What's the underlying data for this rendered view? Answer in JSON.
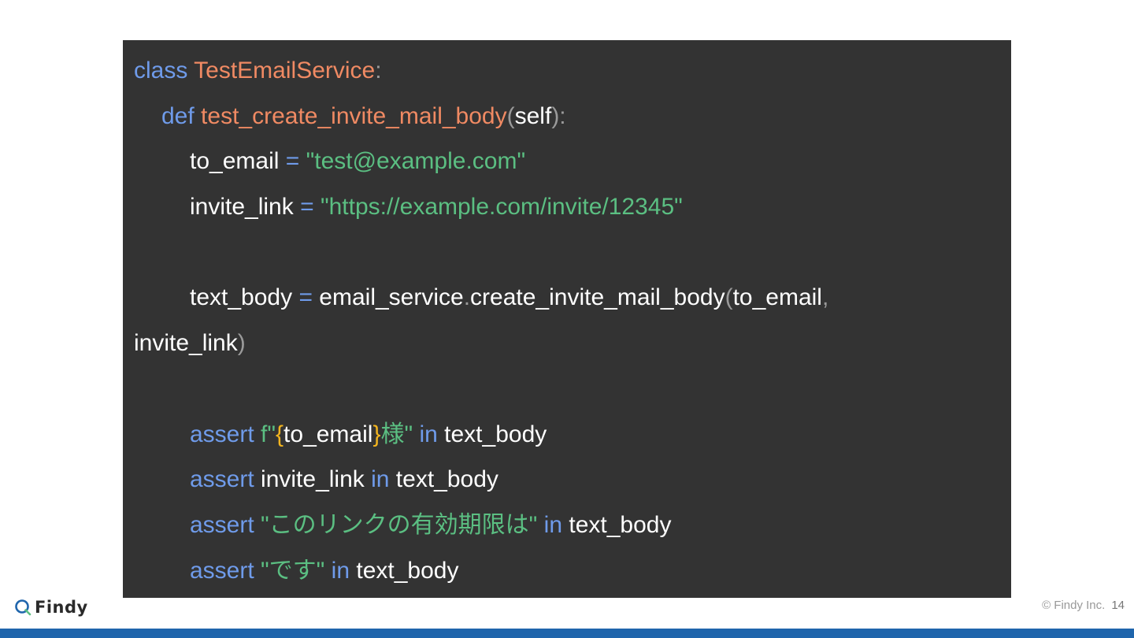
{
  "code": {
    "lines": [
      {
        "indent": 0,
        "tokens": [
          {
            "t": "kw",
            "v": "class "
          },
          {
            "t": "nm",
            "v": "TestEmailService"
          },
          {
            "t": "pn",
            "v": ":"
          }
        ]
      },
      {
        "indent": 1,
        "tokens": [
          {
            "t": "kw",
            "v": "def "
          },
          {
            "t": "nm",
            "v": "test_create_invite_mail_body"
          },
          {
            "t": "pn",
            "v": "("
          },
          {
            "t": "tx",
            "v": "self"
          },
          {
            "t": "pn",
            "v": "):"
          }
        ]
      },
      {
        "indent": 2,
        "tokens": [
          {
            "t": "tx",
            "v": "to_email "
          },
          {
            "t": "kw",
            "v": "= "
          },
          {
            "t": "st",
            "v": "\"test@example.com\""
          }
        ]
      },
      {
        "indent": 2,
        "tokens": [
          {
            "t": "tx",
            "v": "invite_link "
          },
          {
            "t": "kw",
            "v": "= "
          },
          {
            "t": "st",
            "v": "\"https://example.com/invite/12345\""
          }
        ]
      },
      {
        "indent": 0,
        "tokens": []
      },
      {
        "indent": 2,
        "tokens": [
          {
            "t": "tx",
            "v": "text_body "
          },
          {
            "t": "kw",
            "v": "= "
          },
          {
            "t": "tx",
            "v": "email_service"
          },
          {
            "t": "pn",
            "v": "."
          },
          {
            "t": "tx",
            "v": "create_invite_mail_body"
          },
          {
            "t": "pn",
            "v": "("
          },
          {
            "t": "tx",
            "v": "to_email"
          },
          {
            "t": "pn",
            "v": ","
          }
        ]
      },
      {
        "indent": 0,
        "tokens": [
          {
            "t": "tx",
            "v": "invite_link"
          },
          {
            "t": "pn",
            "v": ")"
          }
        ]
      },
      {
        "indent": 0,
        "tokens": []
      },
      {
        "indent": 2,
        "tokens": [
          {
            "t": "kw",
            "v": "assert "
          },
          {
            "t": "st",
            "v": "f\""
          },
          {
            "t": "br",
            "v": "{"
          },
          {
            "t": "tx",
            "v": "to_email"
          },
          {
            "t": "br",
            "v": "}"
          },
          {
            "t": "st",
            "v": "様\" "
          },
          {
            "t": "kw",
            "v": "in "
          },
          {
            "t": "tx",
            "v": "text_body"
          }
        ]
      },
      {
        "indent": 2,
        "tokens": [
          {
            "t": "kw",
            "v": "assert "
          },
          {
            "t": "tx",
            "v": "invite_link "
          },
          {
            "t": "kw",
            "v": "in "
          },
          {
            "t": "tx",
            "v": "text_body"
          }
        ]
      },
      {
        "indent": 2,
        "tokens": [
          {
            "t": "kw",
            "v": "assert "
          },
          {
            "t": "st",
            "v": "\"このリンクの有効期限は\" "
          },
          {
            "t": "kw",
            "v": "in "
          },
          {
            "t": "tx",
            "v": "text_body"
          }
        ]
      },
      {
        "indent": 2,
        "tokens": [
          {
            "t": "kw",
            "v": "assert "
          },
          {
            "t": "st",
            "v": "\"です\" "
          },
          {
            "t": "kw",
            "v": "in "
          },
          {
            "t": "tx",
            "v": "text_body"
          }
        ]
      }
    ]
  },
  "footer": {
    "logo_text": "Findy",
    "logo_icon": "findy-logo-icon",
    "copyright": "© Findy Inc.",
    "page_number": "14"
  },
  "colors": {
    "code_bg": "#333333",
    "keyword": "#6f9bea",
    "name": "#f08a63",
    "string": "#5bbf82",
    "punct": "#9a9a9a",
    "brace": "#f2b41f",
    "bottom_bar": "#1f65ac"
  }
}
